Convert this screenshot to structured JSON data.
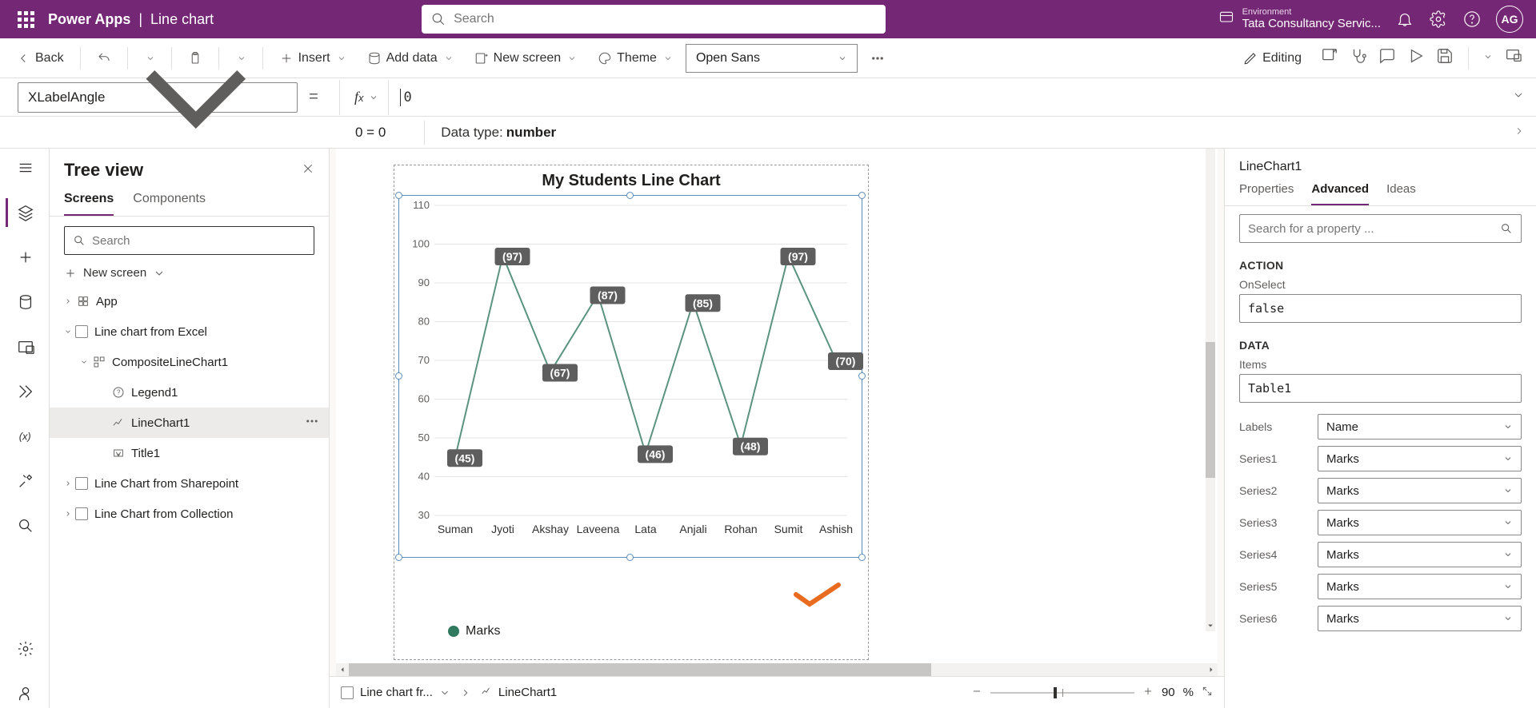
{
  "topbar": {
    "brand": "Power Apps",
    "separator": "|",
    "page": "Line chart",
    "search_placeholder": "Search",
    "env_label": "Environment",
    "env_value": "Tata Consultancy Servic...",
    "avatar_initials": "AG"
  },
  "toolbar": {
    "back": "Back",
    "insert": "Insert",
    "add_data": "Add data",
    "new_screen": "New screen",
    "theme": "Theme",
    "font_value": "Open Sans",
    "editing": "Editing"
  },
  "formula": {
    "prop_name": "XLabelAngle",
    "value": "0",
    "result": "0  =  0",
    "datatype_label": "Data type:",
    "datatype_value": "number"
  },
  "tree": {
    "title": "Tree view",
    "tab_screens": "Screens",
    "tab_components": "Components",
    "search_placeholder": "Search",
    "new_screen": "New screen",
    "app": "App",
    "screen1": "Line chart from Excel",
    "composite": "CompositeLineChart1",
    "legend": "Legend1",
    "linechart": "LineChart1",
    "title1": "Title1",
    "screen2": "Line Chart from Sharepoint",
    "screen3": "Line Chart from Collection"
  },
  "chart_data": {
    "type": "line",
    "title": "My Students Line Chart",
    "categories": [
      "Suman",
      "Jyoti",
      "Akshay",
      "Laveena",
      "Lata",
      "Anjali",
      "Rohan",
      "Sumit",
      "Ashish"
    ],
    "values": [
      45,
      97,
      67,
      87,
      46,
      85,
      48,
      97,
      70
    ],
    "ylabel": "",
    "xlabel": "",
    "ylim": [
      30,
      110
    ],
    "legend": "Marks"
  },
  "footer": {
    "bc_screen": "Line chart fr...",
    "bc_control": "LineChart1",
    "zoom_value": "90",
    "zoom_unit": "%"
  },
  "prop": {
    "control_name": "LineChart1",
    "tab_props": "Properties",
    "tab_adv": "Advanced",
    "tab_ideas": "Ideas",
    "search_placeholder": "Search for a property ...",
    "section_action": "ACTION",
    "onselect_label": "OnSelect",
    "onselect_value": "false",
    "section_data": "DATA",
    "items_label": "Items",
    "items_value": "Table1",
    "labels_label": "Labels",
    "labels_value": "Name",
    "series1_label": "Series1",
    "series1_value": "Marks",
    "series2_label": "Series2",
    "series2_value": "Marks",
    "series3_label": "Series3",
    "series3_value": "Marks",
    "series4_label": "Series4",
    "series4_value": "Marks",
    "series5_label": "Series5",
    "series5_value": "Marks",
    "series6_label": "Series6",
    "series6_value": "Marks"
  }
}
